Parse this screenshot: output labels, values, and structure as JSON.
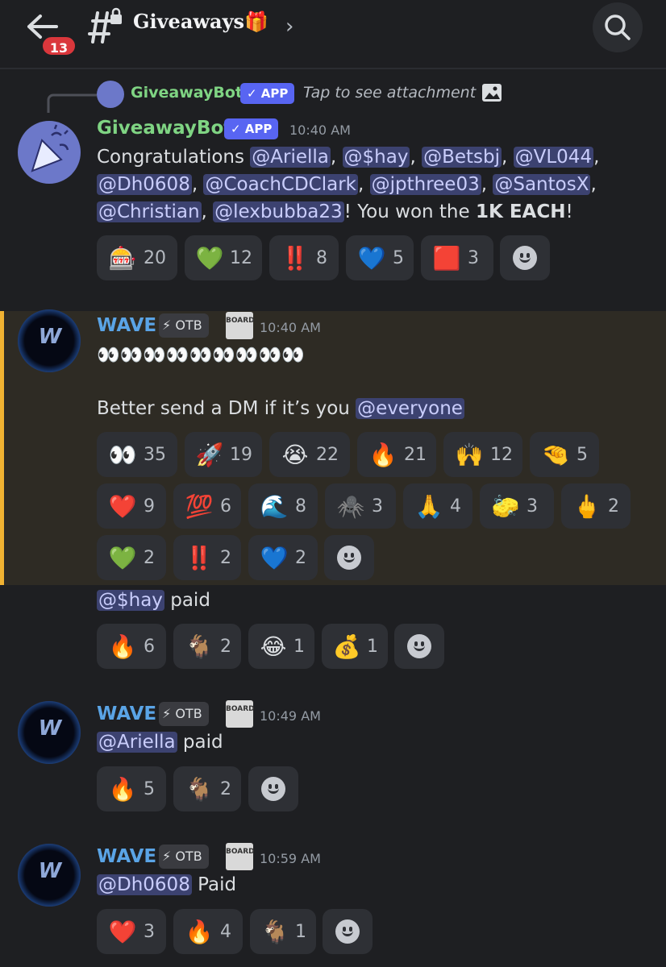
{
  "header": {
    "unread_count": "13",
    "channel_title": "Giveaways🎁"
  },
  "reply_ref": {
    "author": "GiveawayBot",
    "app_label": "✓ APP",
    "text": "Tap to see attachment"
  },
  "messages": [
    {
      "author": "GiveawayBot",
      "app_label": "✓ APP",
      "time": "10:40 AM",
      "line1_prefix": "Congratulations ",
      "mentions": [
        "@Ariella",
        "@$hay",
        "@Betsbj",
        "@VL044",
        "@Dh0608",
        "@CoachCDClark",
        "@jpthree03",
        "@SantosX",
        "@Christian",
        "@lexbubba23"
      ],
      "line_suffix": "! You won the ",
      "prize": "1K EACH",
      "end": "!",
      "reactions": [
        {
          "emoji": "🎰",
          "count": "20"
        },
        {
          "emoji": "💚",
          "count": "12"
        },
        {
          "emoji": "‼️",
          "count": "8"
        },
        {
          "emoji": "💙",
          "count": "5"
        },
        {
          "emoji": "🟥",
          "count": "3"
        }
      ]
    },
    {
      "author": "WAVE",
      "role_tag": "⚡ OTB",
      "board_icon": "BOARD",
      "time": "10:40 AM",
      "line1": "👀👀👀👀👀👀👀👀👀",
      "line2": "Better send a DM if it’s you ",
      "mention": "@everyone",
      "reactions": [
        {
          "emoji": "👀",
          "count": "35"
        },
        {
          "emoji": "🚀",
          "count": "19"
        },
        {
          "emoji": "😭",
          "count": "22"
        },
        {
          "emoji": "🔥",
          "count": "21"
        },
        {
          "emoji": "🙌",
          "count": "12"
        },
        {
          "emoji": "🤏",
          "count": "5"
        },
        {
          "emoji": "❤️",
          "count": "9"
        },
        {
          "emoji": "💯",
          "count": "6"
        },
        {
          "emoji": "🌊",
          "count": "8"
        },
        {
          "emoji": "🕷️",
          "count": "3"
        },
        {
          "emoji": "🙏",
          "count": "4"
        },
        {
          "emoji": "🧽",
          "count": "3"
        },
        {
          "emoji": "🖕",
          "count": "2"
        },
        {
          "emoji": "💚",
          "count": "2"
        },
        {
          "emoji": "‼️",
          "count": "2"
        },
        {
          "emoji": "💙",
          "count": "2"
        }
      ]
    },
    {
      "mention": "@$hay",
      "text": " paid",
      "reactions": [
        {
          "emoji": "🔥",
          "count": "6"
        },
        {
          "emoji": "🐐",
          "count": "2"
        },
        {
          "emoji": "😂",
          "count": "1"
        },
        {
          "emoji": "💰",
          "count": "1"
        }
      ]
    },
    {
      "author": "WAVE",
      "role_tag": "⚡ OTB",
      "board_icon": "BOARD",
      "time": "10:49 AM",
      "mention": "@Ariella",
      "text": " paid",
      "reactions": [
        {
          "emoji": "🔥",
          "count": "5"
        },
        {
          "emoji": "🐐",
          "count": "2"
        }
      ]
    },
    {
      "author": "WAVE",
      "role_tag": "⚡ OTB",
      "board_icon": "BOARD",
      "time": "10:59 AM",
      "mention": "@Dh0608",
      "text": " Paid",
      "reactions": [
        {
          "emoji": "❤️",
          "count": "3"
        },
        {
          "emoji": "🔥",
          "count": "4"
        },
        {
          "emoji": "🐐",
          "count": "1"
        }
      ]
    }
  ],
  "colors": {
    "bot_name": "#7fd483",
    "wave_name": "#5aa4e6",
    "mention_bg": "#3c4270",
    "highlight_border": "#f0b232"
  }
}
